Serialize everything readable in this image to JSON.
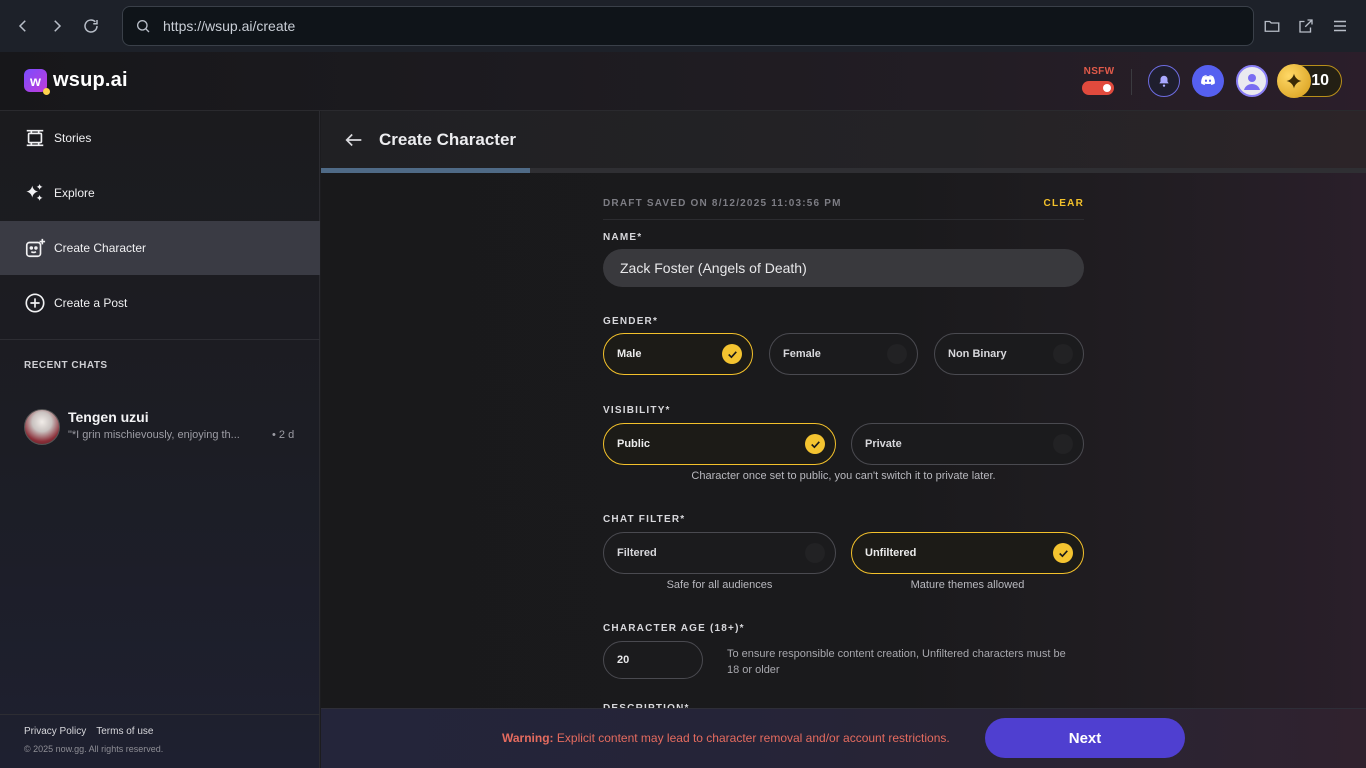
{
  "browser": {
    "url": "https://wsup.ai/create"
  },
  "header": {
    "logo_text": "wsup.ai",
    "nsfw_label": "NSFW",
    "nsfw_enabled": true,
    "coins": "10"
  },
  "sidebar": {
    "items": [
      {
        "label": "Stories",
        "icon": "stories-icon"
      },
      {
        "label": "Explore",
        "icon": "sparkles-icon"
      },
      {
        "label": "Create Character",
        "icon": "character-add-icon"
      },
      {
        "label": "Create a Post",
        "icon": "plus-circle-icon"
      }
    ],
    "recent_title": "RECENT CHATS",
    "recent_chats": [
      {
        "name": "Tengen uzui",
        "preview": "\"*I grin mischievously, enjoying th...",
        "time": "• 2 d"
      }
    ],
    "footer": {
      "privacy": "Privacy Policy",
      "terms": "Terms of use",
      "copyright": "© 2025 now.gg. All rights reserved."
    }
  },
  "main": {
    "title": "Create Character",
    "progress": 0.2,
    "draft_text": "DRAFT SAVED ON 8/12/2025 11:03:56 PM",
    "clear_label": "CLEAR",
    "name_label": "NAME*",
    "name_value": "Zack Foster (Angels of Death)",
    "gender_label": "GENDER*",
    "gender_options": [
      "Male",
      "Female",
      "Non Binary"
    ],
    "gender_selected": "Male",
    "visibility_label": "VISIBILITY*",
    "visibility_options": [
      "Public",
      "Private"
    ],
    "visibility_selected": "Public",
    "visibility_hint": "Character once set to public, you can't switch it to private later.",
    "filter_label": "CHAT FILTER*",
    "filter_options": [
      "Filtered",
      "Unfiltered"
    ],
    "filter_selected": "Unfiltered",
    "filter_hints": [
      "Safe for all audiences",
      "Mature themes allowed"
    ],
    "age_label": "CHARACTER AGE (18+)*",
    "age_value": "20",
    "age_note": "To ensure responsible content creation, Unfiltered characters must be 18 or older",
    "description_label": "DESCRIPTION*"
  },
  "footer_bar": {
    "warning_prefix": "Warning:",
    "warning_text": "Explicit content may lead to character removal and/or account restrictions.",
    "next_label": "Next"
  },
  "colors": {
    "accent_yellow": "#f3c12b",
    "primary_purple": "#4f3fd0",
    "nsfw_red": "#e14a3d"
  }
}
